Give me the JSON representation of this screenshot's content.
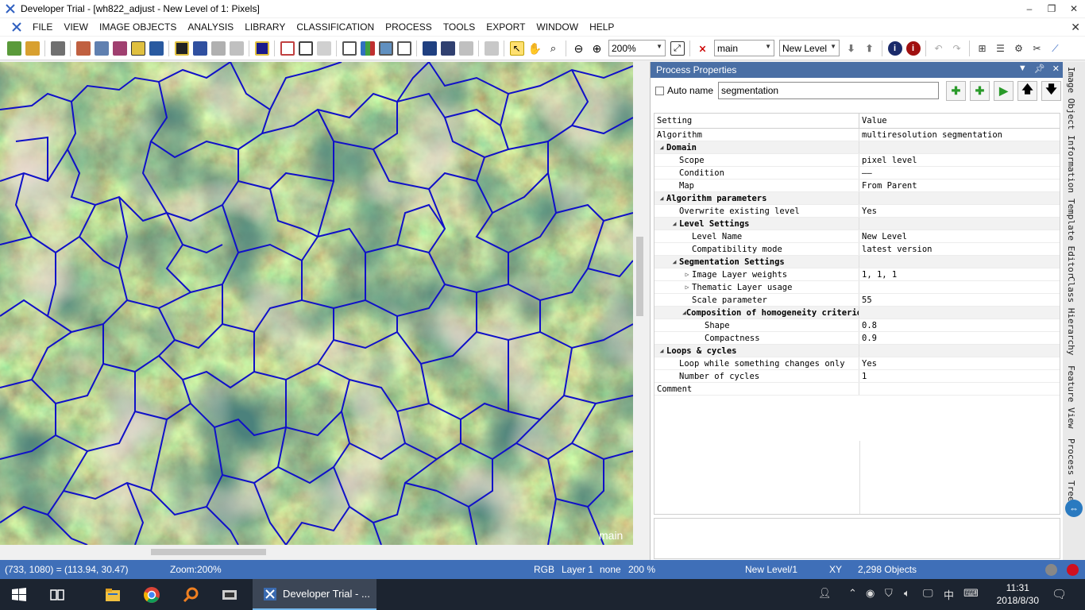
{
  "window": {
    "title": "Developer Trial - [wh822_adjust - New Level of 1: Pixels]",
    "minimize": "–",
    "restore": "❐",
    "close": "✕"
  },
  "menu": {
    "items": [
      "FILE",
      "VIEW",
      "IMAGE OBJECTS",
      "ANALYSIS",
      "LIBRARY",
      "CLASSIFICATION",
      "PROCESS",
      "TOOLS",
      "EXPORT",
      "WINDOW",
      "HELP"
    ],
    "mdi_close": "✕"
  },
  "toolbar": {
    "zoom_value": "200%",
    "map_value": "main",
    "level_value": "New Level"
  },
  "view": {
    "map_label": "main"
  },
  "panel": {
    "title": "Process Properties",
    "auto_name_label": "Auto name",
    "name_value": "segmentation",
    "columns": {
      "setting": "Setting",
      "value": "Value"
    },
    "rows": [
      {
        "indent": 0,
        "setting": "Algorithm",
        "value": "multiresolution segmentation"
      },
      {
        "indent": 1,
        "group": true,
        "setting": "Domain",
        "value": ""
      },
      {
        "indent": 2,
        "setting": "Scope",
        "value": "pixel level"
      },
      {
        "indent": 2,
        "setting": "Condition",
        "value": "——"
      },
      {
        "indent": 2,
        "setting": "Map",
        "value": "From Parent"
      },
      {
        "indent": 1,
        "group": true,
        "setting": "Algorithm parameters",
        "value": ""
      },
      {
        "indent": 2,
        "setting": "Overwrite existing level",
        "value": "Yes"
      },
      {
        "indent": 2,
        "group": true,
        "setting": "Level Settings",
        "value": ""
      },
      {
        "indent": 3,
        "setting": "Level Name",
        "value": "New Level"
      },
      {
        "indent": 3,
        "setting": "Compatibility mode",
        "value": "latest version"
      },
      {
        "indent": 2,
        "group": true,
        "setting": "Segmentation Settings",
        "value": ""
      },
      {
        "indent": 3,
        "collapsed": true,
        "setting": "Image Layer weights",
        "value": "1, 1, 1"
      },
      {
        "indent": 3,
        "collapsed": true,
        "setting": "Thematic Layer usage",
        "value": ""
      },
      {
        "indent": 3,
        "setting": "Scale parameter",
        "value": "55"
      },
      {
        "indent": 3,
        "group": true,
        "setting": "Composition of homogeneity criterion",
        "value": ""
      },
      {
        "indent": 4,
        "setting": "Shape",
        "value": "0.8"
      },
      {
        "indent": 4,
        "setting": "Compactness",
        "value": "0.9"
      },
      {
        "indent": 1,
        "group": true,
        "setting": "Loops & cycles",
        "value": ""
      },
      {
        "indent": 2,
        "setting": "Loop while something changes only",
        "value": "Yes"
      },
      {
        "indent": 2,
        "setting": "Number of cycles",
        "value": "1"
      },
      {
        "indent": 0,
        "setting": "Comment",
        "value": ""
      }
    ]
  },
  "side_tabs": [
    "Image Object Information",
    "Template Editor",
    "Class Hierarchy",
    "Feature View",
    "Process Tree"
  ],
  "status": {
    "coords": "(733, 1080) = (113.94, 30.47)",
    "zoom": "Zoom:200%",
    "mode": "RGB",
    "layer": "Layer 1",
    "none": "none",
    "pct": "200 %",
    "level": "New Level/1",
    "xy": "XY",
    "objects": "2,298 Objects"
  },
  "taskbar": {
    "active_app": "Developer Trial - ...",
    "time": "11:31",
    "date": "2018/8/30",
    "ime": "中"
  },
  "colors": {
    "status_bar": "#3f6fb8",
    "panel_header": "#4a6fa5",
    "segment_outline": "#1010c8"
  }
}
